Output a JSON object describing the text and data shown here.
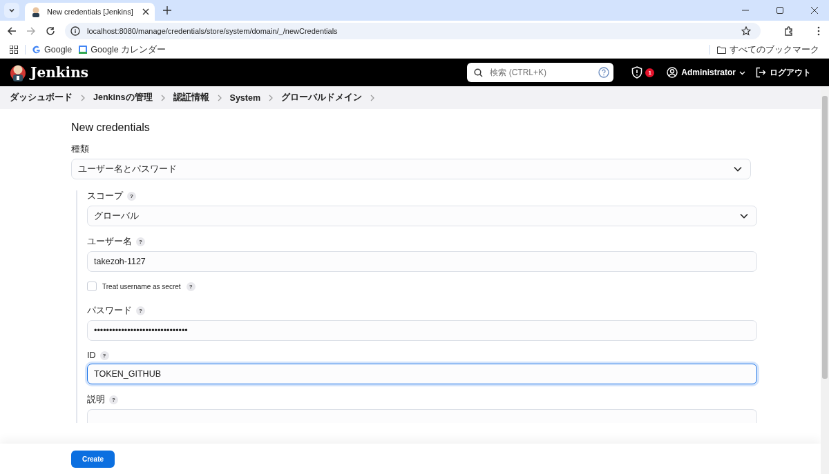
{
  "browser": {
    "tab_title": "New credentials [Jenkins]",
    "url": "localhost:8080/manage/credentials/store/system/domain/_/newCredentials",
    "bookmarks": [
      "Google",
      "Google カレンダー"
    ],
    "all_bookmarks": "すべてのブックマーク"
  },
  "header": {
    "logo": "Jenkins",
    "search_placeholder": "検索 (CTRL+K)",
    "alert_count": "1",
    "user": "Administrator",
    "logout": "ログアウト"
  },
  "breadcrumbs": [
    "ダッシュボード",
    "Jenkinsの管理",
    "認証情報",
    "System",
    "グローバルドメイン"
  ],
  "page": {
    "title": "New credentials",
    "kind_label": "種類",
    "kind_value": "ユーザー名とパスワード",
    "fields": [
      {
        "kind": "select",
        "label": "スコープ",
        "help": "?",
        "value": "グローバル",
        "focused": false
      },
      {
        "kind": "text",
        "label": "ユーザー名",
        "help": "?",
        "value": "takezoh-1127",
        "focused": false
      },
      {
        "kind": "checkbox",
        "label": "Treat username as secret",
        "help": "?",
        "checked": false
      },
      {
        "kind": "text",
        "label": "パスワード",
        "help": "?",
        "value": "•••••••••••••••••••••••••••••••",
        "focused": false
      },
      {
        "kind": "text",
        "label": "ID",
        "help": "?",
        "value": "TOKEN_GITHUB",
        "focused": true
      },
      {
        "kind": "textarea",
        "label": "説明",
        "help": "?",
        "focused": false
      }
    ]
  },
  "footer": {
    "button": "Create"
  }
}
